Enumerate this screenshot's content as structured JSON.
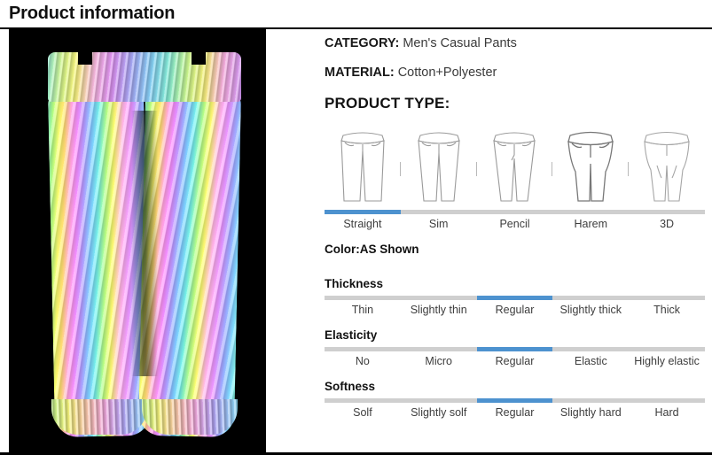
{
  "header": {
    "title": "Product information"
  },
  "product_image": {
    "alt": "Reflective holographic jogger pants on black background",
    "background_color": "#000000"
  },
  "specs": [
    {
      "key": "CATEGORY:",
      "value": "Men's Casual  Pants"
    },
    {
      "key": "MATERIAL:",
      "value": "Cotton+Polyester"
    }
  ],
  "product_type": {
    "title": "PRODUCT TYPE:",
    "options": [
      {
        "label": "Straight",
        "icon": "straight-pants-icon",
        "selected": true
      },
      {
        "label": "Sim",
        "icon": "slim-pants-icon",
        "selected": false
      },
      {
        "label": "Pencil",
        "icon": "pencil-pants-icon",
        "selected": false
      },
      {
        "label": "Harem",
        "icon": "harem-pants-icon",
        "selected": false
      },
      {
        "label": "3D",
        "icon": "3d-pants-icon",
        "selected": false
      }
    ]
  },
  "color": {
    "label": "Color:AS Shown"
  },
  "attributes": [
    {
      "name": "thickness",
      "title": "Thickness",
      "options": [
        "Thin",
        "Slightly thin",
        "Regular",
        "Slightly thick",
        "Thick"
      ],
      "selected_index": 2
    },
    {
      "name": "elasticity",
      "title": "Elasticity",
      "options": [
        "No",
        "Micro",
        "Regular",
        "Elastic",
        "Highly elastic"
      ],
      "selected_index": 2
    },
    {
      "name": "softness",
      "title": "Softness",
      "options": [
        "Solf",
        "Slightly solf",
        "Regular",
        "Slightly hard",
        "Hard"
      ],
      "selected_index": 2
    }
  ],
  "colors": {
    "accent": "#4d92cf",
    "track": "#cfcfcf",
    "text": "#3d3d3d",
    "heading": "#121212",
    "rule": "#000000"
  }
}
